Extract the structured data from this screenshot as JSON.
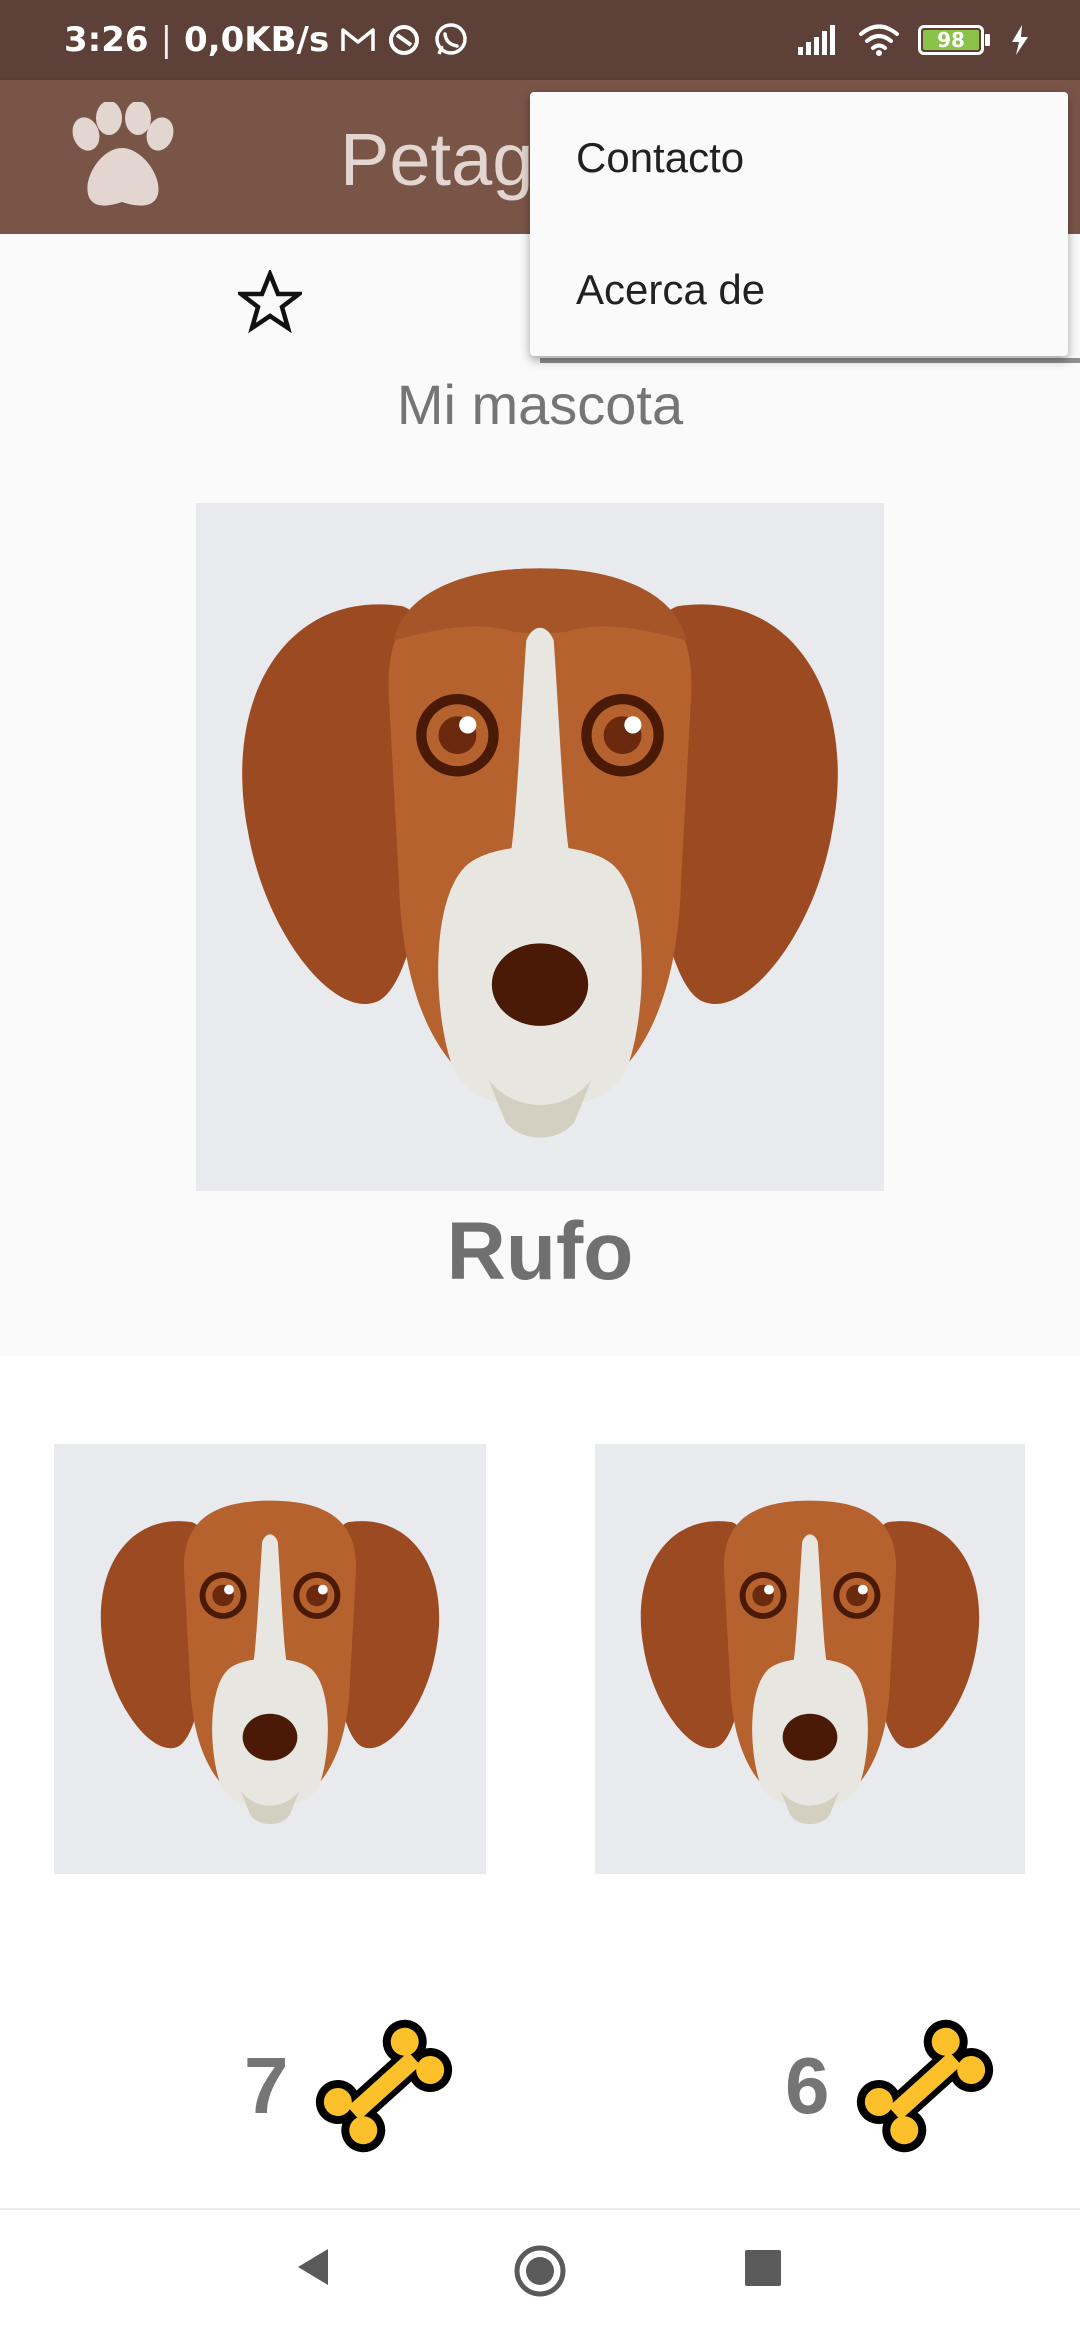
{
  "status_bar": {
    "time": "3:26",
    "network_speed": "0,0KB/s",
    "notification_icons": [
      "gmail-icon",
      "app-icon",
      "whatsapp-icon"
    ],
    "battery_level": "98",
    "system_icons": [
      "signal-icon",
      "wifi-icon",
      "battery-icon",
      "charging-icon"
    ]
  },
  "app_bar": {
    "title": "Petagram",
    "icon": "paw-icon",
    "color": "#795548"
  },
  "menu": {
    "items": [
      {
        "label": "Contacto"
      },
      {
        "label": "Acerca de"
      }
    ]
  },
  "profile": {
    "favorite_icon": "star-outline-icon",
    "section_title": "Mi mascota",
    "pet_name": "Rufo"
  },
  "gallery": {
    "items": [
      {
        "rating": "7",
        "icon": "bone-icon"
      },
      {
        "rating": "6",
        "icon": "bone-icon"
      }
    ]
  },
  "nav_bar": {
    "icons": [
      "back-icon",
      "home-icon",
      "recents-icon"
    ]
  }
}
